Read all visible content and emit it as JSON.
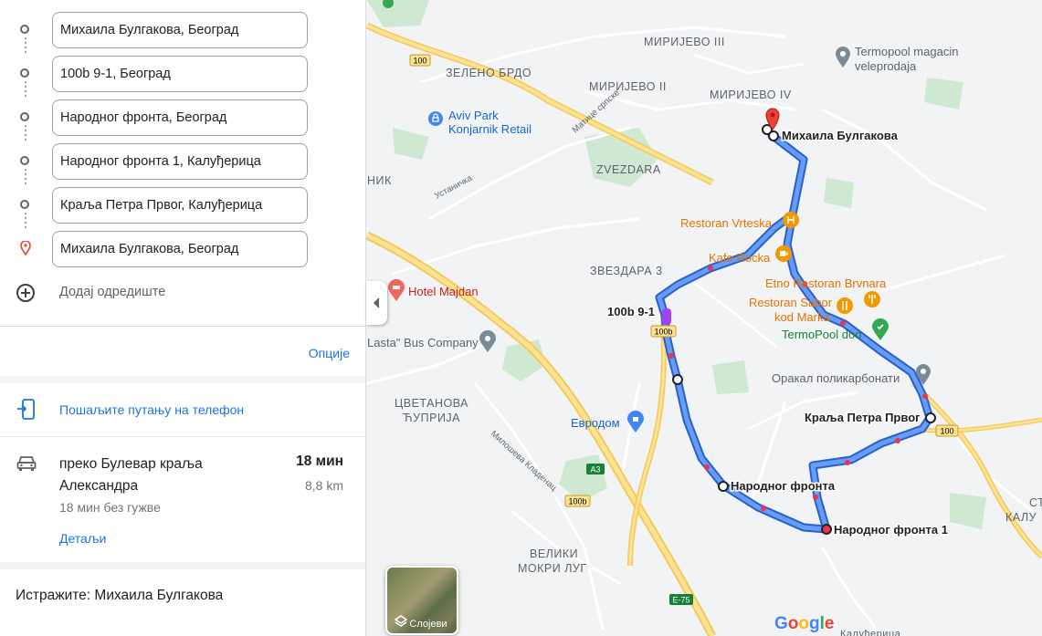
{
  "waypoints": [
    {
      "value": "Михаила Булгакова, Београд",
      "type": "origin"
    },
    {
      "value": "100b 9-1, Београд",
      "type": "stop"
    },
    {
      "value": "Народног фронта, Београд",
      "type": "stop"
    },
    {
      "value": "Народног фронта 1, Калуђерица",
      "type": "stop"
    },
    {
      "value": "Краља Петра Првог, Калуђерица",
      "type": "stop"
    },
    {
      "value": "Михаила Булгакова, Београд",
      "type": "destination"
    }
  ],
  "add_destination_label": "Додај одредиште",
  "options_label": "Опције",
  "send_to_phone_label": "Пошаљите путању на телефон",
  "route": {
    "title": "преко Булевар краља Александра",
    "time": "18 мин",
    "distance": "8,8 km",
    "traffic_note": "18 мин без гужве",
    "details_label": "Детаљи"
  },
  "explore_label": "Истражите: Михаила Булгакова",
  "map": {
    "layers_label": "Слојеви",
    "google_logo_letters": [
      "G",
      "o",
      "o",
      "g",
      "l",
      "e"
    ],
    "google_logo_colors": [
      "#4285f4",
      "#ea4335",
      "#fbbc05",
      "#4285f4",
      "#34a853",
      "#ea4335"
    ],
    "colors": {
      "background": "#f1f3f4",
      "route": "#4a80f5",
      "route_outline": "#2a5fcf",
      "road_major": "#fdd663",
      "park": "#c8e6c9",
      "traffic": "#e8364c"
    },
    "place_labels": {
      "mirijevo3": "МИРИЈЕВО III",
      "mirijevo2": "МИРИЈЕВО II",
      "mirijevo4": "МИРИЈЕВО IV",
      "zeleno_brdo": "ЗЕЛЕНО БРДО",
      "zvezdara": "ZVEZDARA",
      "zvezdara3": "ЗВЕЗДАРА 3",
      "cvetanova1": "ЦВЕТАНОВА",
      "cvetanova2": "ЋУПРИЈА",
      "veliki_mokri1": "ВЕЛИКИ",
      "veliki_mokri2": "МОКРИ ЛУГ",
      "nik": "НИК",
      "kalu": "КАЛУ",
      "st": "СТ",
      "kaludjerica_bottom": "Калуђерица"
    },
    "poi_labels": {
      "termopool_mag1": "Termopool magacin",
      "termopool_mag2": "veleprodaja",
      "aviv1": "Aviv Park",
      "aviv2": "Konjarnik Retail",
      "vrteska": "Restoran Vrteska",
      "kafe": "Kafe Rocka",
      "brvnara": "Etno Restoran Brvnara",
      "sabor1": "Restoran Sabor",
      "sabor2": "kod Marka",
      "termopool_doo": "TermoPool doo",
      "orakal": "Оракал поликарбонати",
      "hotel": "Hotel Majdan",
      "bus": "Lasta\" Bus Company",
      "eurodom": "Евродом"
    },
    "street_labels": {
      "ustanicka": "Устаничка",
      "matice": "Матице српске",
      "milosa": "Милошева Кладенац"
    },
    "road_shields": {
      "r100_a": "100",
      "r100_b": "100b",
      "r100_c": "100",
      "r100_d": "100b",
      "a3": "A3",
      "e75": "E-75"
    },
    "route_labels": {
      "start": "Михаила Булгакова",
      "s1": "100b 9-1",
      "s2": "Народног фронта",
      "s3": "Народног фронта 1",
      "s4": "Краља Петра Првог"
    }
  }
}
